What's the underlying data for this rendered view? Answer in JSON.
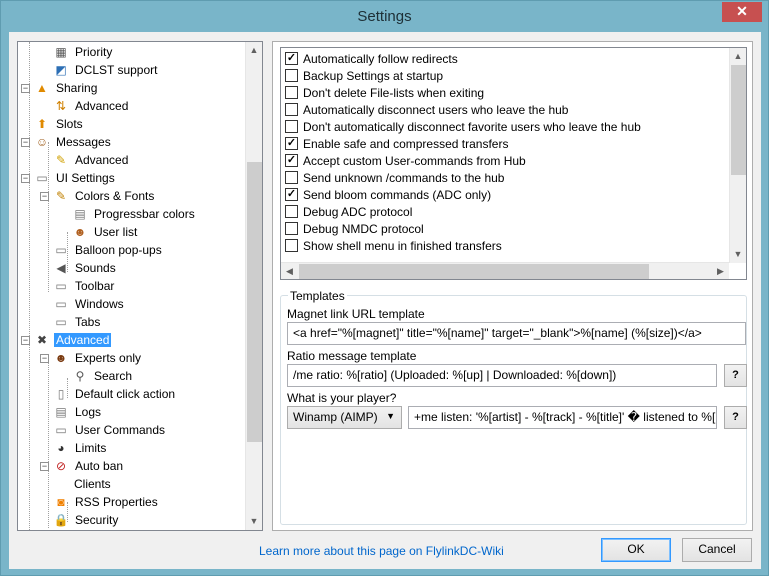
{
  "window": {
    "title": "Settings",
    "close_glyph": "✕"
  },
  "tree": {
    "items": [
      {
        "label": "Priority",
        "icon": "priority-icon",
        "glyph": "▦",
        "color": "#555",
        "level": 2
      },
      {
        "label": "DCLST support",
        "icon": "dclst-icon",
        "glyph": "◩",
        "color": "#2d6fb5",
        "level": 2
      },
      {
        "label": "Sharing",
        "icon": "sharing-icon",
        "glyph": "▲",
        "color": "#e08a00",
        "level": 1,
        "expand": "−"
      },
      {
        "label": "Advanced",
        "icon": "advanced-sharing-icon",
        "glyph": "⇅",
        "color": "#d08000",
        "level": 2
      },
      {
        "label": "Slots",
        "icon": "slots-icon",
        "glyph": "⬆",
        "color": "#e08a00",
        "level": 1
      },
      {
        "label": "Messages",
        "icon": "messages-icon",
        "glyph": "☺",
        "color": "#a06020",
        "level": 1,
        "expand": "−"
      },
      {
        "label": "Advanced",
        "icon": "advanced-messages-icon",
        "glyph": "✎",
        "color": "#d0a000",
        "level": 2
      },
      {
        "label": "UI Settings",
        "icon": "ui-settings-icon",
        "glyph": "▭",
        "color": "#777",
        "level": 1,
        "expand": "−"
      },
      {
        "label": "Colors & Fonts",
        "icon": "colors-fonts-icon",
        "glyph": "✎",
        "color": "#c08000",
        "level": 2,
        "expand": "−"
      },
      {
        "label": "Progressbar colors",
        "icon": "progressbar-icon",
        "glyph": "▤",
        "color": "#777",
        "level": 3
      },
      {
        "label": "User list",
        "icon": "user-list-icon",
        "glyph": "☻",
        "color": "#b06020",
        "level": 3
      },
      {
        "label": "Balloon pop-ups",
        "icon": "balloon-icon",
        "glyph": "▭",
        "color": "#777",
        "level": 2
      },
      {
        "label": "Sounds",
        "icon": "sounds-icon",
        "glyph": "◀",
        "color": "#555",
        "level": 2
      },
      {
        "label": "Toolbar",
        "icon": "toolbar-icon",
        "glyph": "▭",
        "color": "#777",
        "level": 2
      },
      {
        "label": "Windows",
        "icon": "windows-icon",
        "glyph": "▭",
        "color": "#777",
        "level": 2
      },
      {
        "label": "Tabs",
        "icon": "tabs-icon",
        "glyph": "▭",
        "color": "#777",
        "level": 2
      },
      {
        "label": "Advanced",
        "icon": "advanced-tools-icon",
        "glyph": "✖",
        "color": "#444",
        "level": 1,
        "expand": "−",
        "selected": true
      },
      {
        "label": "Experts only",
        "icon": "experts-icon",
        "glyph": "☻",
        "color": "#7a3a10",
        "level": 2,
        "expand": "−"
      },
      {
        "label": "Search",
        "icon": "search-icon",
        "glyph": "⚲",
        "color": "#555",
        "level": 3
      },
      {
        "label": "Default click action",
        "icon": "mouse-icon",
        "glyph": "▯",
        "color": "#777",
        "level": 2
      },
      {
        "label": "Logs",
        "icon": "logs-icon",
        "glyph": "▤",
        "color": "#777",
        "level": 2
      },
      {
        "label": "User Commands",
        "icon": "user-commands-icon",
        "glyph": "▭",
        "color": "#777",
        "level": 2
      },
      {
        "label": "Limits",
        "icon": "limits-icon",
        "glyph": "◕",
        "color": "#333",
        "level": 2
      },
      {
        "label": "Auto ban",
        "icon": "auto-ban-icon",
        "glyph": "⊘",
        "color": "#c02020",
        "level": 2,
        "expand": "−"
      },
      {
        "label": "Clients",
        "icon": "",
        "glyph": "",
        "color": "#000",
        "level": 3
      },
      {
        "label": "RSS Properties",
        "icon": "rss-icon",
        "glyph": "◙",
        "color": "#f08000",
        "level": 2
      },
      {
        "label": "Security",
        "icon": "security-icon",
        "glyph": "🔒",
        "color": "#c09000",
        "level": 2
      }
    ]
  },
  "options": [
    {
      "label": "Automatically follow redirects",
      "checked": true
    },
    {
      "label": "Backup Settings at startup",
      "checked": false
    },
    {
      "label": "Don't delete File-lists when exiting",
      "checked": false
    },
    {
      "label": "Automatically disconnect users who leave the hub",
      "checked": false
    },
    {
      "label": "Don't automatically disconnect favorite users who leave the hub",
      "checked": false
    },
    {
      "label": "Enable safe and compressed transfers",
      "checked": true
    },
    {
      "label": "Accept custom User-commands from Hub",
      "checked": true
    },
    {
      "label": "Send unknown /commands to the hub",
      "checked": false
    },
    {
      "label": "Send bloom commands (ADC only)",
      "checked": true
    },
    {
      "label": "Debug ADC protocol",
      "checked": false
    },
    {
      "label": "Debug NMDC protocol",
      "checked": false
    },
    {
      "label": "Show shell menu in finished transfers",
      "checked": false
    }
  ],
  "templates": {
    "legend": "Templates",
    "magnet_label": "Magnet link URL template",
    "magnet_value": "<a href=\"%[magnet]\" title=\"%[name]\" target=\"_blank\">%[name] (%[size])</a>",
    "ratio_label": "Ratio message template",
    "ratio_value": "/me ratio: %[ratio] (Uploaded: %[up] | Downloaded: %[down])",
    "player_label": "What is your player?",
    "player_selected": "Winamp (AIMP)",
    "player_value": "+me listen: '%[artist] - %[track] - %[title]' � listened to %[percent]",
    "help_label": "?"
  },
  "footer": {
    "wiki_link": "Learn more about this page on FlylinkDC-Wiki",
    "ok_label": "OK",
    "cancel_label": "Cancel"
  },
  "scroll_glyphs": {
    "up": "▲",
    "down": "▼",
    "left": "◀",
    "right": "▶",
    "caret": "▼"
  }
}
